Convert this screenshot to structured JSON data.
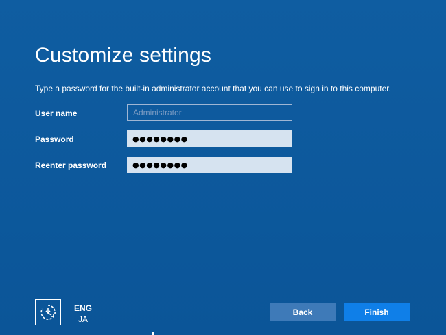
{
  "header": {
    "title": "Customize settings",
    "description": "Type a password for the built-in administrator account that you can use to sign in to this computer."
  },
  "form": {
    "username": {
      "label": "User name",
      "placeholder": "Administrator",
      "value": ""
    },
    "password": {
      "label": "Password",
      "masked_value": "●●●●●●●●"
    },
    "reenter_password": {
      "label": "Reenter password",
      "masked_value": "●●●●●●●●"
    }
  },
  "footer": {
    "ease_of_access_icon": "ease-of-access-icon",
    "language": {
      "primary": "ENG",
      "secondary": "JA"
    },
    "back_label": "Back",
    "finish_label": "Finish"
  },
  "colors": {
    "background": "#0d5a9e",
    "input_fill": "#d6e3f0",
    "back_button": "#3e7ab8",
    "finish_button": "#0f7fe8"
  }
}
